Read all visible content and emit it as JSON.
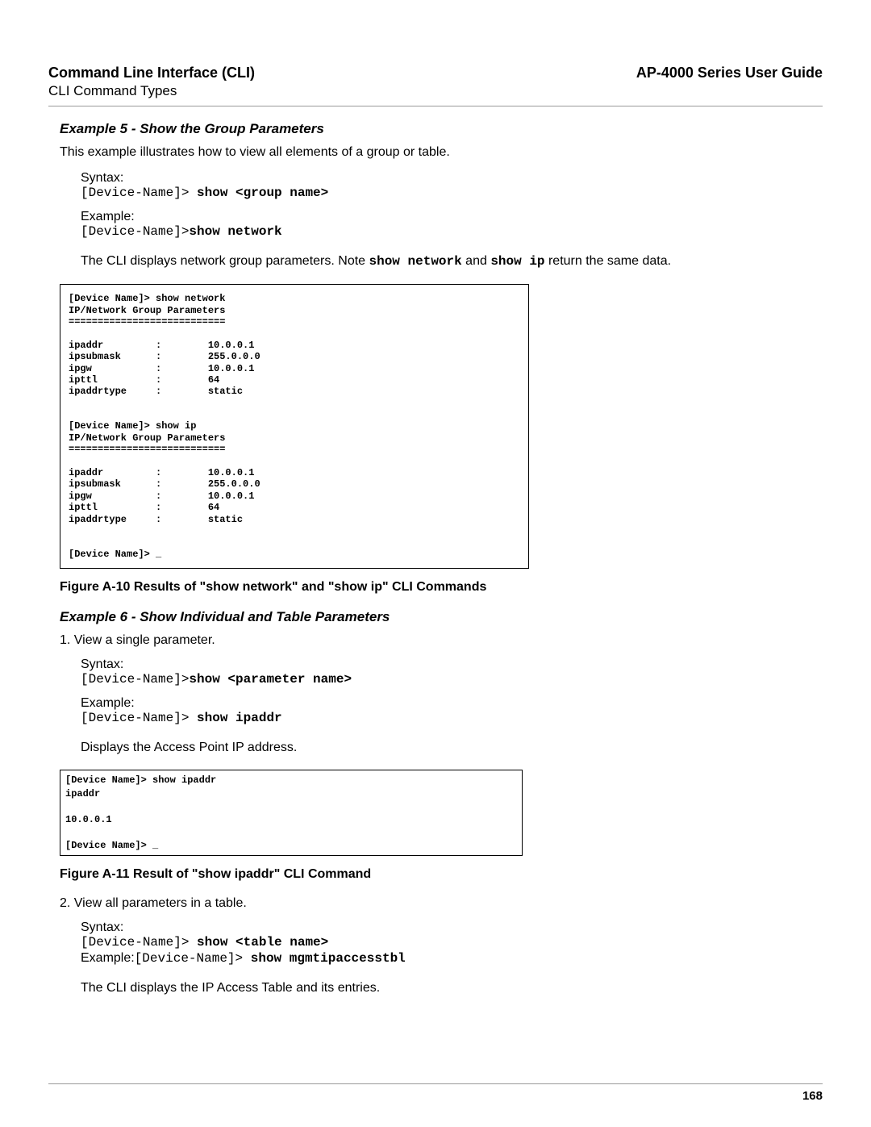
{
  "header": {
    "left_title": "Command Line Interface (CLI)",
    "right_title": "AP-4000 Series User Guide",
    "subheader": "CLI Command Types"
  },
  "example5": {
    "title": "Example 5 - Show the Group Parameters",
    "intro": "This example illustrates how to view all elements of a group or table.",
    "syntax_label": "Syntax:",
    "syntax_prompt": "[Device-Name]> ",
    "syntax_cmd": "show <group name>",
    "example_label": "Example:",
    "example_prompt": "[Device-Name]>",
    "example_cmd": "show network",
    "explain_pre": "The CLI displays network group parameters. Note ",
    "explain_m1": "show network",
    "explain_mid": " and ",
    "explain_m2": "show ip",
    "explain_post": " return the same data."
  },
  "terminal1": "[Device Name]> show network\nIP/Network Group Parameters\n===========================\n\nipaddr         :        10.0.0.1\nipsubmask      :        255.0.0.0\nipgw           :        10.0.0.1\nipttl          :        64\nipaddrtype     :        static\n\n\n[Device Name]> show ip\nIP/Network Group Parameters\n===========================\n\nipaddr         :        10.0.0.1\nipsubmask      :        255.0.0.0\nipgw           :        10.0.0.1\nipttl          :        64\nipaddrtype     :        static\n\n\n[Device Name]> _",
  "figure_a10": "Figure A-10 Results of \"show network\" and \"show ip\" CLI Commands",
  "example6": {
    "title": "Example 6 - Show Individual and Table Parameters",
    "item1": "1. View a single parameter.",
    "syntax_label": "Syntax:",
    "syntax_prompt": "[Device-Name]>",
    "syntax_cmd": "show <parameter name>",
    "example_label": "Example:",
    "example_prompt": "[Device-Name]> ",
    "example_cmd": "show ipaddr",
    "displays": "Displays the Access Point IP address."
  },
  "terminal2": "[Device Name]> show ipaddr\nipaddr\n\n10.0.0.1\n\n[Device Name]> _",
  "figure_a11": "Figure A-11 Result of \"show ipaddr\" CLI Command",
  "part2": {
    "item2": "2. View all parameters in a table.",
    "syntax_label": "Syntax:",
    "syntax_prompt": "[Device-Name]> ",
    "syntax_cmd": "show <table name>",
    "example_label": "Example:",
    "example_prompt": "[Device-Name]> ",
    "example_cmd": "show mgmtipaccesstbl",
    "explain": "The CLI displays the IP Access Table and its entries."
  },
  "page_number": "168"
}
